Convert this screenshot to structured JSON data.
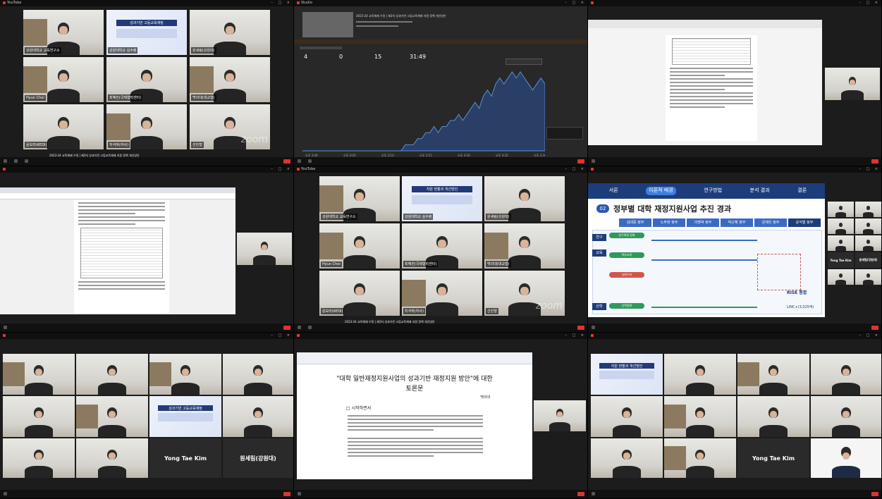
{
  "meeting_title": "2023-24 교육체제 수정 | 제3차 성과기반 고등교육체제 지원 정책 개선방안",
  "yt_brand": "YouTube",
  "studio_brand": "Studio",
  "participants": {
    "p1": "강원대학교 교육연구소",
    "p2": "강원대학교 실수령",
    "p3": "원세림(강원대)",
    "p4": "Hyun Choi",
    "p5": "최혜진(국제협력센터)",
    "p6": "백의대(대교협)",
    "p7": "윤보라(KEDI)",
    "p8": "지석하(하사)",
    "p9": "선민형"
  },
  "slide_small": {
    "line1": "성과기반 고등교육재정",
    "line2": "지원 현황과 개선방안"
  },
  "zoom_watermark": "zoom",
  "studio": {
    "stats": [
      {
        "value": "4"
      },
      {
        "value": "0"
      },
      {
        "value": "15"
      },
      {
        "value": "31:49"
      }
    ],
    "xaxis": [
      "오후 3:00",
      "오후 3:05",
      "오후 3:10",
      "오후 3:15",
      "오후 3:20",
      "오후 3:25",
      "오후 3:30"
    ],
    "series": [
      0,
      0,
      0,
      0,
      0,
      0,
      0,
      0,
      0,
      0,
      0,
      0,
      0,
      0,
      0,
      0,
      0,
      0,
      0,
      0,
      0,
      0,
      0,
      0,
      0,
      1,
      1,
      1,
      2,
      2,
      3,
      3,
      4,
      3,
      4,
      4,
      5,
      5,
      6,
      5,
      6,
      7,
      8,
      7,
      9,
      10,
      9,
      11,
      12,
      11,
      12,
      13,
      12,
      13,
      12,
      11,
      10,
      11,
      12,
      11
    ]
  },
  "slide_big": {
    "nav": [
      "서론",
      "이론적 배경",
      "연구방법",
      "분석 결과",
      "결론"
    ],
    "num": "02",
    "heading": "정부별 대학 재정지원사업 추진 경과",
    "govs": [
      "김대중 정부",
      "노무현 정부",
      "이명박 정부",
      "박근혜 정부",
      "문재인 정부",
      "윤석열 정부"
    ],
    "rows": [
      "연구",
      "교육",
      "산학"
    ],
    "tags": [
      "연구역량 강화",
      "학부교육",
      "사회수요",
      "산학협력"
    ],
    "rise": "RISE 통합",
    "linc": "LINC+(3,025억)"
  },
  "remote": {
    "p10": "Yong Tae Kim",
    "p11": "원세림(강원대)"
  },
  "doc_main": {
    "title": "\"대학 일반재정지원사업의 성과기반 재정지원 방안\"에 대한",
    "subtitle": "토론문",
    "author": "백의대",
    "section": "시작하면서"
  }
}
